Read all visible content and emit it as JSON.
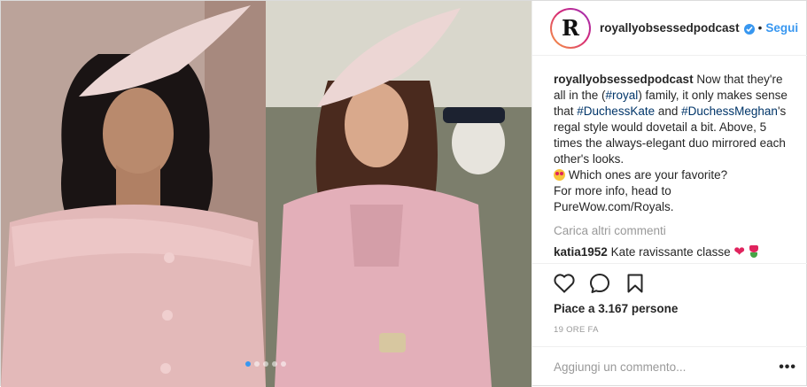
{
  "header": {
    "avatar_letter": "R",
    "username": "royallyobsessedpodcast",
    "separator": "•",
    "follow_label": "Segui"
  },
  "caption": {
    "username": "royallyobsessedpodcast",
    "text_1": "Now that they're all in the (",
    "tag_royal": "#royal",
    "text_2": ") family, it only makes sense that ",
    "tag_kate": "#DuchessKate",
    "text_3": " and ",
    "tag_meghan": "#DuchessMeghan",
    "text_4": "'s regal style would dovetail a bit. Above, 5 times the always-elegant duo mirrored each other's looks.",
    "text_5": " Which ones are your favorite?",
    "text_6": "For more info, head to PureWow.com/Royals."
  },
  "load_more_label": "Carica altri commenti",
  "comment": {
    "username": "katia1952",
    "text": "Kate ravissante classe",
    "heart": "❤"
  },
  "likes": "Piace a 3.167 persone",
  "time": "19 ORE FA",
  "add_comment": {
    "placeholder": "Aggiungi un commento...",
    "more": "•••"
  },
  "carousel": {
    "count": 5,
    "active_index": 0
  },
  "colors": {
    "link": "#3897f0",
    "hashtag": "#003569",
    "muted": "#999999"
  },
  "icons": [
    "heart-icon",
    "comment-icon",
    "bookmark-icon",
    "verified-badge-icon"
  ]
}
